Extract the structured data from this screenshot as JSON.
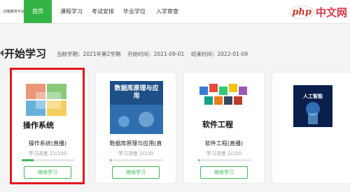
{
  "nav": {
    "logo_text": "...绿整教育平台",
    "items": [
      {
        "label": "首页",
        "active": true
      },
      {
        "label": "课程学习",
        "active": false
      },
      {
        "label": "考试安排",
        "active": false
      },
      {
        "label": "毕业学位",
        "active": false
      },
      {
        "label": "入学审查",
        "active": false
      }
    ],
    "watermark_badge": "php",
    "watermark_text": "中文网"
  },
  "header": {
    "title": "开始学习",
    "current_term_label": "当前学期：2021年第2学期",
    "start_label": "开始时间：2021-09-01",
    "end_label": "结束时间：2022-01-09"
  },
  "courses": [
    {
      "name": "操作系统(直播)",
      "progress_text": "学习进度 22/100",
      "progress": 0.22,
      "button": "继续学习",
      "thumb_title": "操作系统"
    },
    {
      "name": "数据库原理与应用(直",
      "progress_text": "学习进度 2/100",
      "progress": 0.02,
      "button": "继续学习",
      "thumb_title": "数据库原理与应用"
    },
    {
      "name": "软件工程(直播)",
      "progress_text": "学习进度 2/100",
      "progress": 0.02,
      "button": "继续学习",
      "thumb_title": "软件工程"
    },
    {
      "name": "",
      "progress_text": "",
      "progress": 0,
      "button": "",
      "thumb_title": "人工智能"
    }
  ],
  "colors": {
    "accent": "#34b444",
    "highlight": "#e0191b"
  }
}
